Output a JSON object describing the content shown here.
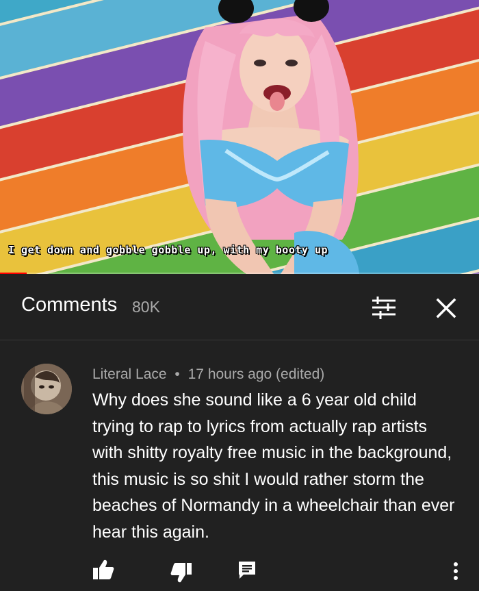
{
  "video": {
    "caption": "I get down and gobble gobble up, with my booty up",
    "progress": 0.055,
    "colors": {
      "progress": "#ff0000",
      "hair": "#f4a7c3",
      "outfit": "#5fb8e6"
    }
  },
  "comments_header": {
    "title": "Comments",
    "count": "80K",
    "icons": {
      "filter": "sort-filter-icon",
      "close": "close-icon"
    }
  },
  "comment": {
    "author": "Literal Lace",
    "separator": "•",
    "time": "17 hours ago (edited)",
    "text": "Why does she sound like a 6 year old child trying to rap to lyrics from actually rap artists with shitty royalty free music in the background, this music is so shit I would rather storm the beaches of Normandy in a wheelchair than ever hear this again.",
    "actions": {
      "like": "thumbs-up-icon",
      "dislike": "thumbs-down-icon",
      "reply": "reply-comment-icon",
      "more": "more-vertical-icon"
    }
  }
}
